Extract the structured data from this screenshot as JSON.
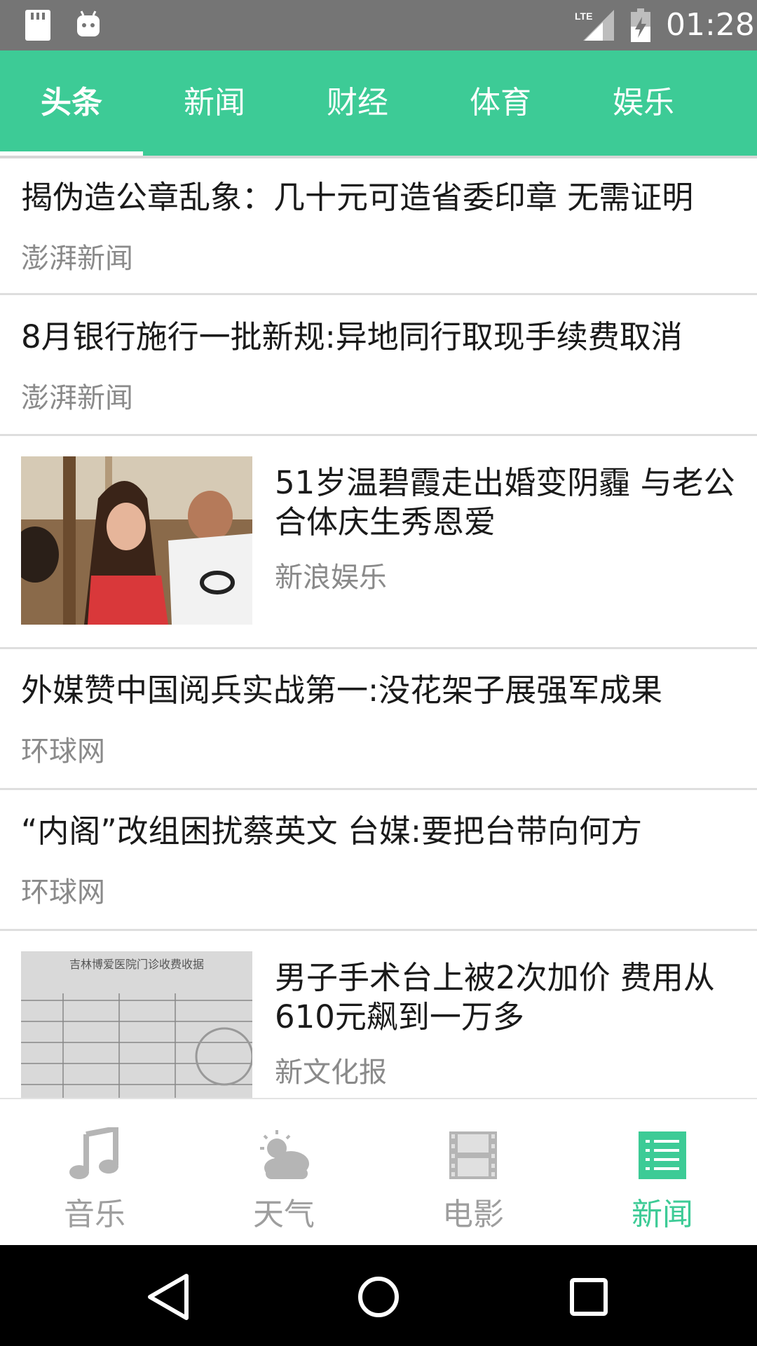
{
  "status_bar": {
    "time": "01:28",
    "network": "LTE"
  },
  "tabs": [
    {
      "label": "头条",
      "active": true
    },
    {
      "label": "新闻",
      "active": false
    },
    {
      "label": "财经",
      "active": false
    },
    {
      "label": "体育",
      "active": false
    },
    {
      "label": "娱乐",
      "active": false
    }
  ],
  "news": [
    {
      "title": "揭伪造公章乱象：几十元可造省委印章 无需证明",
      "source": "澎湃新闻",
      "has_image": false
    },
    {
      "title": "8月银行施行一批新规:异地同行取现手续费取消",
      "source": "澎湃新闻",
      "has_image": false
    },
    {
      "title": "51岁温碧霞走出婚变阴霾 与老公合体庆生秀恩爱",
      "source": "新浪娱乐",
      "has_image": true,
      "image_icon": "photo-people-icon"
    },
    {
      "title": "外媒赞中国阅兵实战第一:没花架子展强军成果",
      "source": "环球网",
      "has_image": false
    },
    {
      "title": "“内阁”改组困扰蔡英文 台媒:要把台带向何方",
      "source": "环球网",
      "has_image": false
    },
    {
      "title": "男子手术台上被2次加价 费用从610元飙到一万多",
      "source": "新文化报",
      "has_image": true,
      "image_icon": "receipt-photo-icon",
      "image_caption": "吉林博爱医院门诊收费收据"
    }
  ],
  "bottom_nav": [
    {
      "label": "音乐",
      "icon": "music-note-icon",
      "active": false
    },
    {
      "label": "天气",
      "icon": "weather-cloud-icon",
      "active": false
    },
    {
      "label": "电影",
      "icon": "film-icon",
      "active": false
    },
    {
      "label": "新闻",
      "icon": "news-list-icon",
      "active": true
    }
  ],
  "colors": {
    "accent": "#3dcb96",
    "inactive": "#9e9e9e",
    "status_bar": "#757575"
  }
}
